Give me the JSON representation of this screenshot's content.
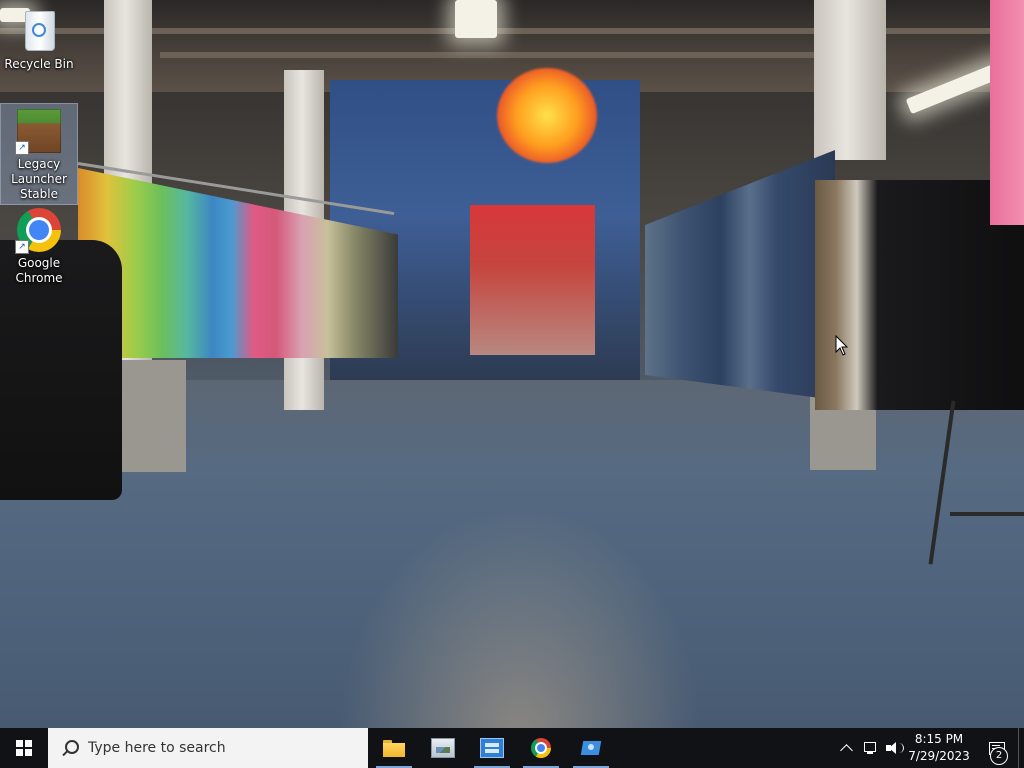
{
  "desktop": {
    "icons": [
      {
        "label": "Recycle Bin",
        "icon": "recycle-bin-icon"
      },
      {
        "label": "Legacy Launcher Stable",
        "icon": "minecraft-grass-block-icon",
        "selected": true
      },
      {
        "label": "Google Chrome",
        "icon": "chrome-icon"
      }
    ]
  },
  "taskbar": {
    "search_placeholder": "Type here to search",
    "pinned_apps": [
      {
        "name": "File Explorer",
        "icon": "folder-icon",
        "active": true
      },
      {
        "name": "Image viewer",
        "icon": "image-viewer-icon",
        "active": false
      },
      {
        "name": "Control panel",
        "icon": "control-panel-icon",
        "active": true
      },
      {
        "name": "Google Chrome",
        "icon": "chrome-icon",
        "active": true
      },
      {
        "name": "Network configuration",
        "icon": "network-config-icon",
        "active": true
      }
    ],
    "tray": {
      "time": "8:15 PM",
      "date": "7/29/2023",
      "notification_count": "2"
    }
  },
  "colors": {
    "taskbar_bg": "#101216",
    "search_bg": "#f3f3f3",
    "active_indicator": "#7ea6d8"
  }
}
